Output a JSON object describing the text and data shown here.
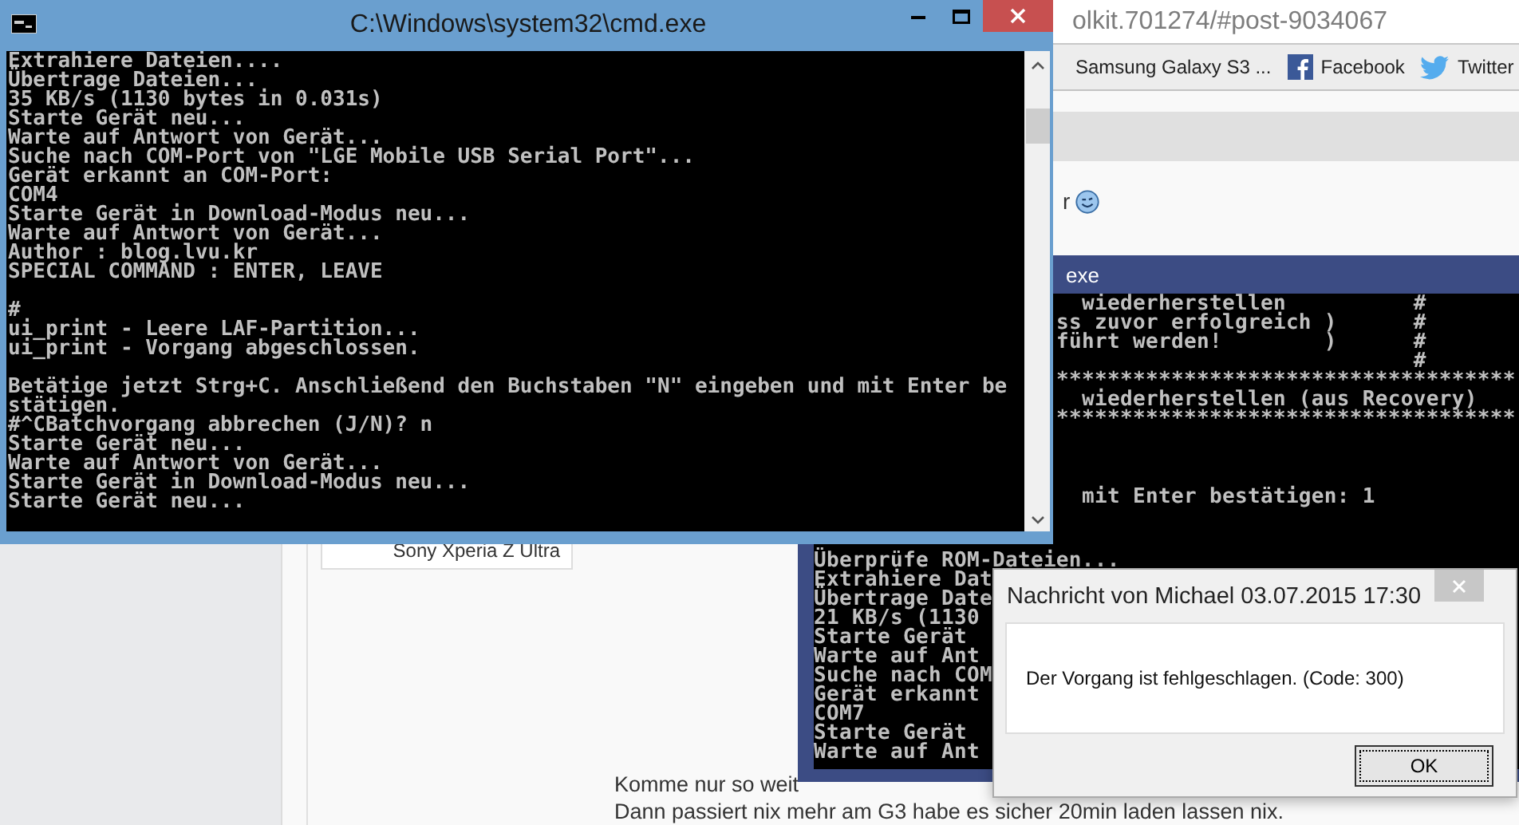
{
  "browser": {
    "address": "olkit.701274/#post-9034067",
    "bookmarks": [
      {
        "label": "Samsung Galaxy S3 ...",
        "kind": "plain"
      },
      {
        "label": "Facebook",
        "kind": "facebook"
      },
      {
        "label": "Twitter",
        "kind": "twitter"
      }
    ],
    "post_fragment": "r",
    "device_caption": "Sony Xperia Z Ultra",
    "post_lines": [
      "Komme nur so weit",
      "Dann passiert nix mehr am G3 habe es sicher 20min laden lassen nix."
    ]
  },
  "console_front": {
    "title": "C:\\Windows\\system32\\cmd.exe",
    "blocks": [
      [
        "Extrahiere Dateien....",
        "Übertrage Dateien...",
        "35 KB/s (1130 bytes in 0.031s)",
        "Starte Gerät neu...",
        "Warte auf Antwort von Gerät...",
        "Suche nach COM-Port von \"LGE Mobile USB Serial Port\"...",
        "Gerät erkannt an COM-Port:",
        "COM4",
        "Starte Gerät in Download-Modus neu...",
        "Warte auf Antwort von Gerät...",
        "Author : blog.lvu.kr",
        "SPECIAL COMMAND : ENTER, LEAVE"
      ],
      [
        "#",
        "ui_print - Leere LAF-Partition...",
        "ui_print - Vorgang abgeschlossen."
      ],
      [
        "Betätige jetzt Strg+C. Anschließend den Buchstaben \"N\" eingeben und mit Enter be",
        "stätigen.",
        "#^CBatchvorgang abbrechen (J/N)? n",
        "Starte Gerät neu...",
        "Warte auf Antwort von Gerät...",
        "Starte Gerät in Download-Modus neu...",
        "Starte Gerät neu..."
      ]
    ]
  },
  "console_back": {
    "title": "exe",
    "upper_blocks": [
      [
        "  wiederherstellen          #",
        "ss zuvor erfolgreich )      #",
        "führt werden!        )      #",
        "                            #",
        "************************************",
        "  wiederherstellen (aus Recovery)",
        "************************************"
      ],
      [
        "  mit Enter bestätigen: 1"
      ]
    ],
    "lower_lines": [
      "Überprüfe ROM-Dateien...",
      "Extrahiere Dat",
      "Übertrage Date",
      "21 KB/s (1130",
      "Starte Gerät",
      "Warte auf Ant",
      "Suche nach COM",
      "Gerät erkannt",
      "COM7",
      "Starte Gerät",
      "Warte auf Ant"
    ]
  },
  "dialog": {
    "title": "Nachricht von Michael 03.07.2015 17:30",
    "message": "Der Vorgang ist fehlgeschlagen. (Code: 300)",
    "button": "OK"
  }
}
